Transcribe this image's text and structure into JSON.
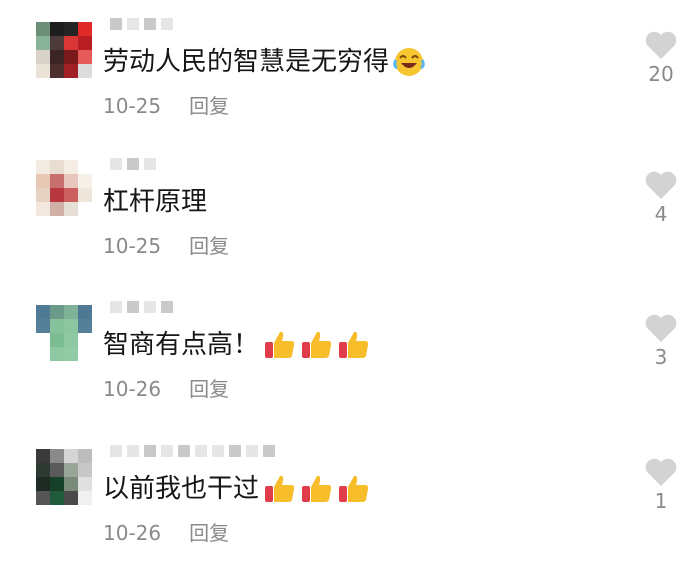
{
  "comments": [
    {
      "text": "劳动人民的智慧是无穷得",
      "emoji": "laughing-face-emoji",
      "date": "10-25",
      "reply_label": "回复",
      "like_count": "20"
    },
    {
      "text": "杠杆原理",
      "emoji": "",
      "date": "10-25",
      "reply_label": "回复",
      "like_count": "4"
    },
    {
      "text": "智商有点高！",
      "emoji": "thumbs-up-emoji x3",
      "date": "10-26",
      "reply_label": "回复",
      "like_count": "3"
    },
    {
      "text": "以前我也干过",
      "emoji": "thumbs-up-emoji x3",
      "date": "10-26",
      "reply_label": "回复",
      "like_count": "1"
    }
  ],
  "colors": {
    "text": "#161616",
    "meta": "#8a8a8a",
    "heart": "#d3d3d3"
  }
}
